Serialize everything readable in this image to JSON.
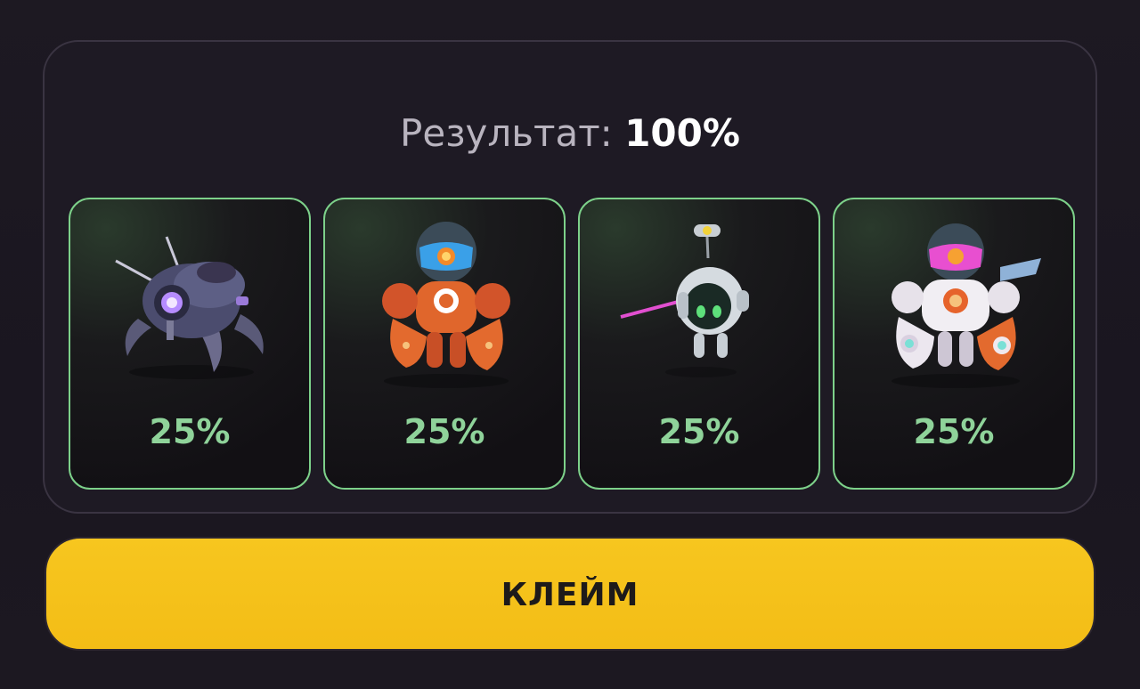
{
  "result": {
    "label": "Результат:",
    "value": "100%"
  },
  "cards": [
    {
      "percent": "25%",
      "icon": "insect-robot-icon",
      "accent": "#7dd18a"
    },
    {
      "percent": "25%",
      "icon": "orange-mech-robot-icon",
      "accent": "#7dd18a"
    },
    {
      "percent": "25%",
      "icon": "drone-bot-icon",
      "accent": "#7dd18a"
    },
    {
      "percent": "25%",
      "icon": "white-mech-robot-icon",
      "accent": "#7dd18a"
    }
  ],
  "claim_button": {
    "label": "КЛЕЙМ",
    "color": "#f5c31b"
  }
}
